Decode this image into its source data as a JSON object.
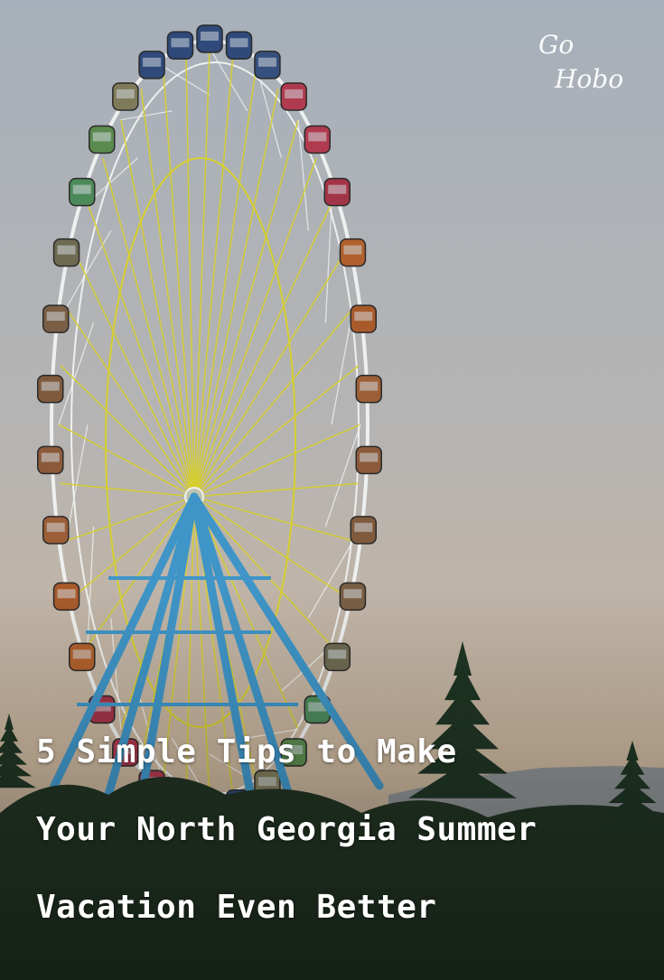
{
  "brand": {
    "line1": "Go",
    "line2": "Hobo"
  },
  "headline": {
    "lines": [
      "5 Simple Tips to Make",
      "Your North Georgia Summer",
      "Vacation Even Better"
    ]
  },
  "photo": {
    "subject": "ferris-wheel",
    "colors": {
      "sky_top": "#a7b0ba",
      "sky_mid": "#b6b4b3",
      "sky_bottom": "#c8b49b",
      "frame_white": "#eef0ef",
      "spokes_yellow": "#d6cf2e",
      "legs_blue": "#3f95c7",
      "trees": "#223323"
    }
  }
}
